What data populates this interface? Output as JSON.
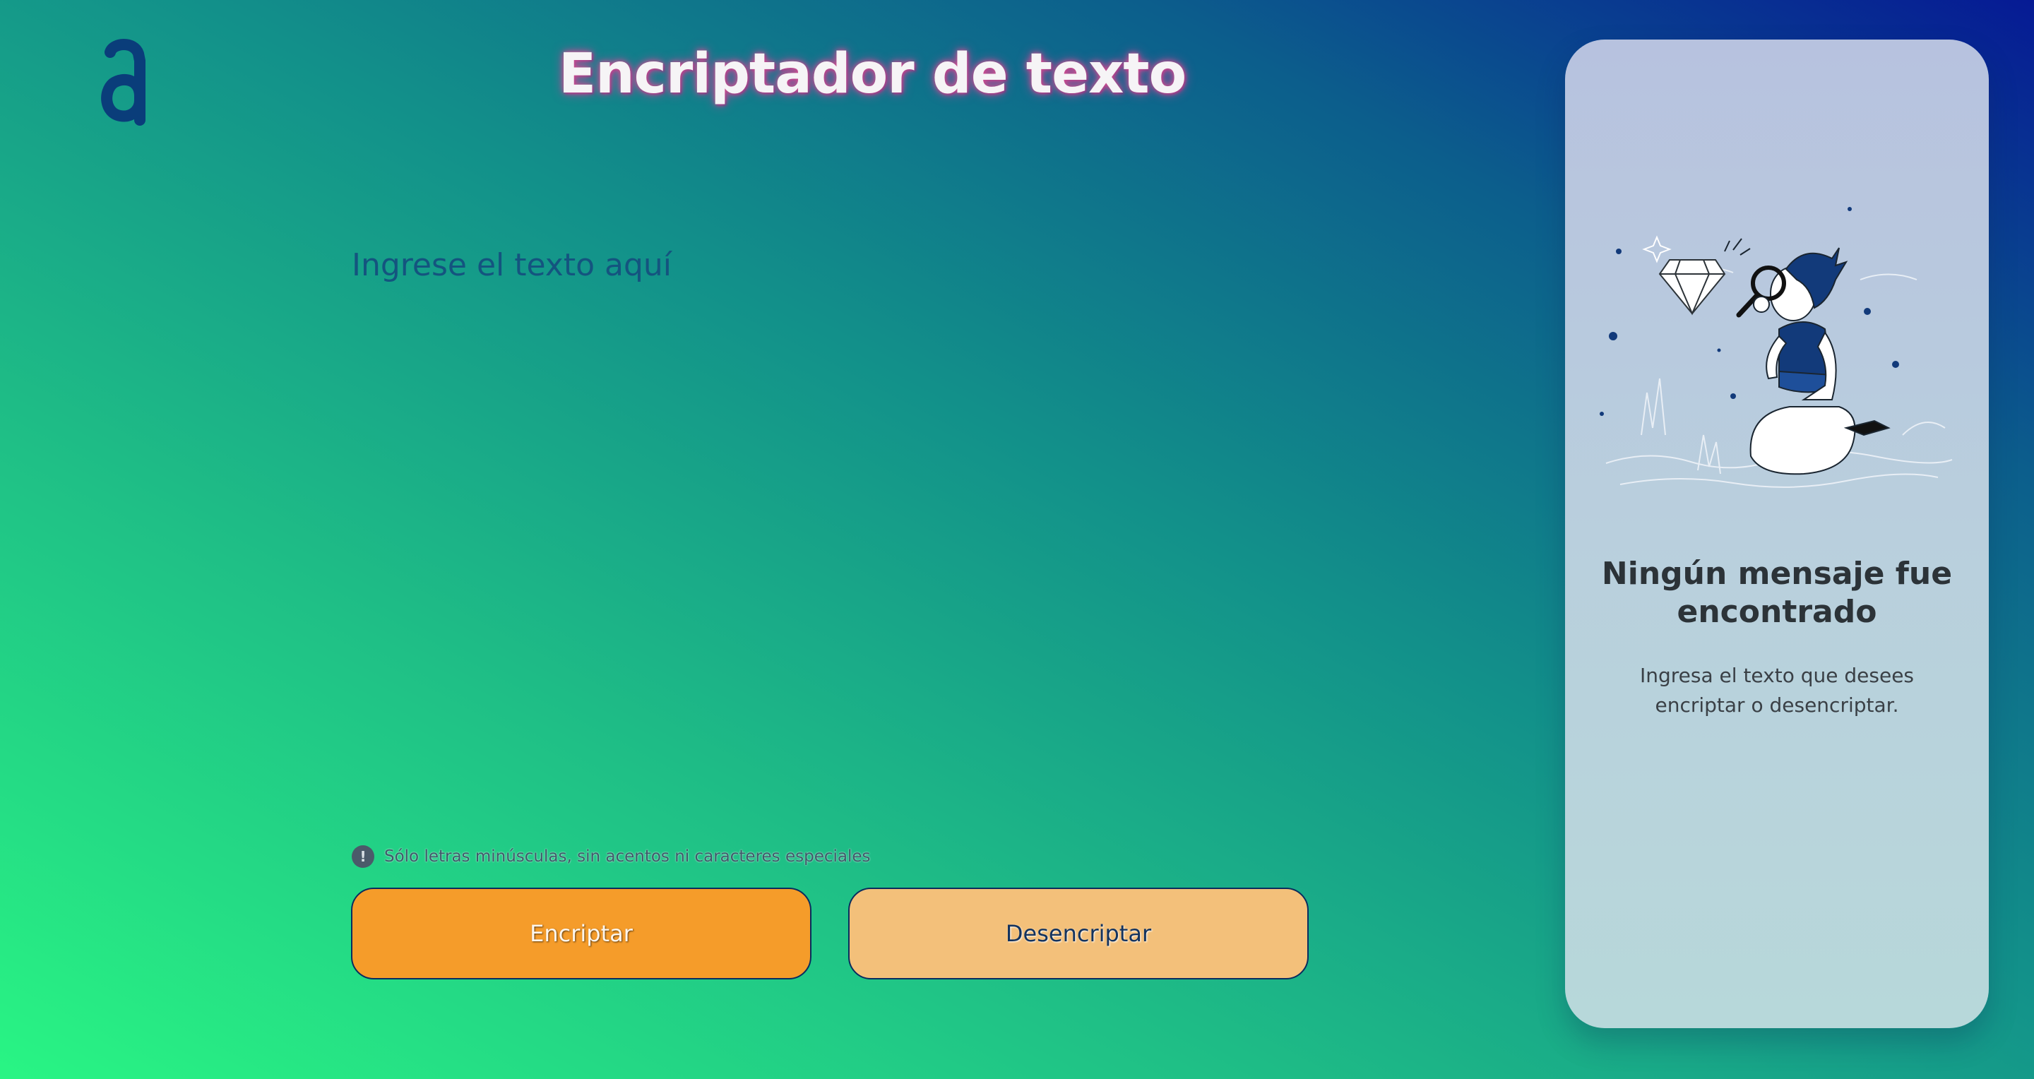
{
  "header": {
    "logo_icon": "alura-logo-icon",
    "title": "Encriptador de texto"
  },
  "input": {
    "placeholder": "Ingrese el texto aquí",
    "value": ""
  },
  "hint": {
    "icon": "exclamation-circle-icon",
    "text": "Sólo letras minúsculas, sin acentos ni caracteres especiales"
  },
  "buttons": {
    "encrypt_label": "Encriptar",
    "decrypt_label": "Desencriptar"
  },
  "output_panel": {
    "illustration": "person-with-magnifying-glass-and-diamond-illustration",
    "title": "Ningún mensaje fue encontrado",
    "text": "Ingresa el texto que desees encriptar o desencriptar."
  },
  "colors": {
    "gradient_start": "#29f584",
    "gradient_end": "#061a94",
    "encrypt_button": "#f59c2a",
    "decrypt_button": "#f3c07a",
    "logo": "#0a3d7a",
    "panel": "#b9cfdd"
  }
}
